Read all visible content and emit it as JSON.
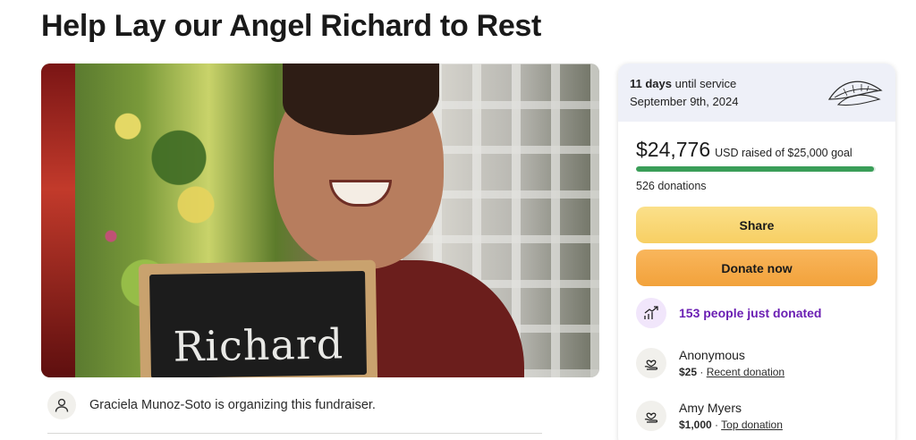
{
  "page_title": "Help Lay our Angel Richard to Rest",
  "hero": {
    "chalkboard_text": "Richard"
  },
  "organizer": {
    "text": "Graciela Munoz-Soto is organizing this fundraiser."
  },
  "service": {
    "days": "11 days",
    "suffix": "until service",
    "date": "September 9th, 2024"
  },
  "fundraiser": {
    "amount": "$24,776",
    "goal_text": "USD raised of $25,000 goal",
    "progress_fraction": 0.991,
    "donations_count": "526 donations",
    "progress_color": "#3a9e58"
  },
  "buttons": {
    "share": "Share",
    "donate": "Donate now"
  },
  "recent_activity": {
    "label": "153 people just donated"
  },
  "donors": [
    {
      "name": "Anonymous",
      "amount": "$25",
      "separator": " · ",
      "tag": "Recent donation"
    },
    {
      "name": "Amy Myers",
      "amount": "$1,000",
      "separator": " · ",
      "tag": "Top donation"
    }
  ],
  "icons": {
    "organizer": "person-icon",
    "leaf": "leaf-icon",
    "trend": "trending-up-icon",
    "donation": "heart-hand-icon"
  }
}
